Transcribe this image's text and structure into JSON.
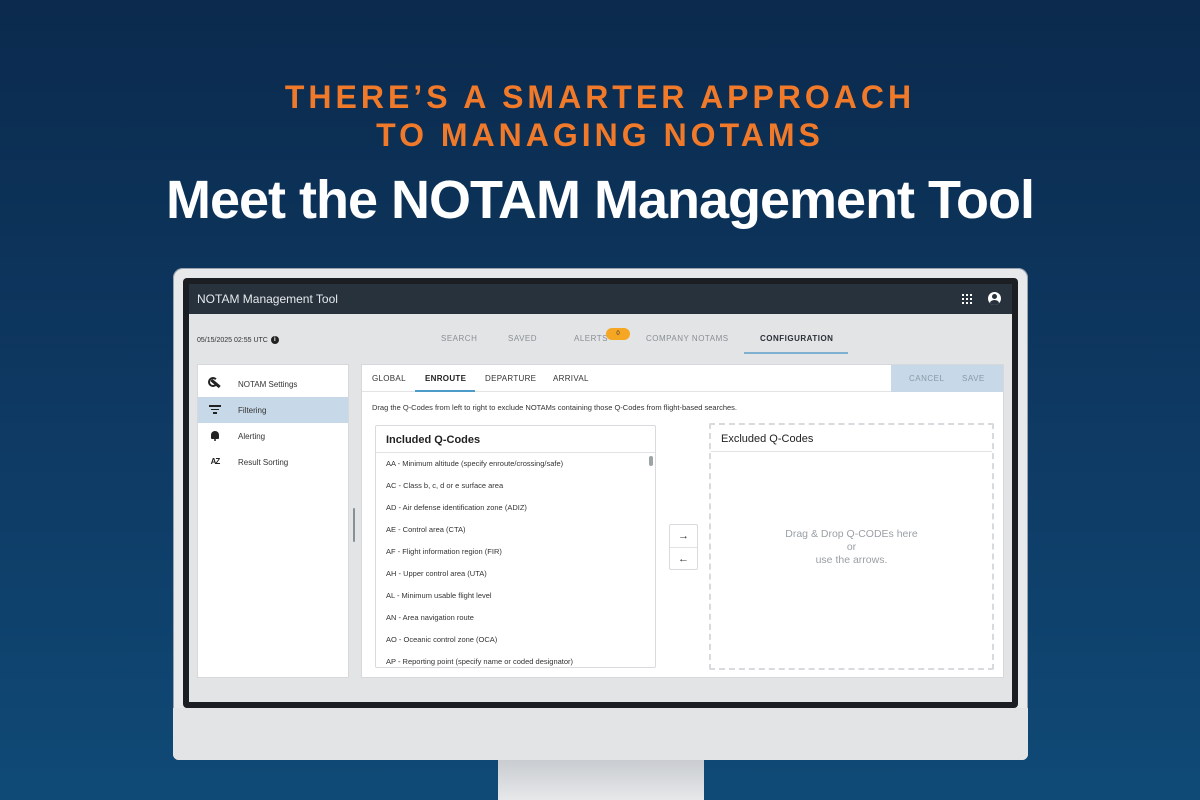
{
  "banner": {
    "kicker_line1": "THERE’S A SMARTER APPROACH",
    "kicker_line2": "TO MANAGING NOTAMS",
    "title": "Meet the NOTAM Management Tool"
  },
  "app": {
    "title": "NOTAM Management Tool",
    "date": "05/15/2025 02:55 UTC",
    "nav_tabs": [
      {
        "label": "SEARCH"
      },
      {
        "label": "SAVED"
      },
      {
        "label": "ALERTS",
        "badge": "0"
      },
      {
        "label": "COMPANY NOTAMs"
      },
      {
        "label": "CONFIGURATION",
        "active": true
      }
    ]
  },
  "sidebar": {
    "items": [
      {
        "label": "NOTAM Settings",
        "icon": "wrench-icon"
      },
      {
        "label": "Filtering",
        "icon": "filter-icon",
        "selected": true
      },
      {
        "label": "Alerting",
        "icon": "bell-icon"
      },
      {
        "label": "Result Sorting",
        "icon": "sort-az-icon",
        "icon_text": "AZ"
      }
    ]
  },
  "panel": {
    "subtabs": [
      {
        "label": "GLOBAL"
      },
      {
        "label": "ENROUTE",
        "active": true
      },
      {
        "label": "DEPARTURE"
      },
      {
        "label": "ARRIVAL"
      }
    ],
    "cancel_label": "CANCEL",
    "save_label": "SAVE",
    "instructions": "Drag the Q-Codes from left to right to exclude NOTAMs containing those Q-Codes from flight-based searches.",
    "included": {
      "title": "Included Q-Codes",
      "codes": [
        "AA - Minimum altitude (specify enroute/crossing/safe)",
        "AC - Class b, c, d or e surface area",
        "AD - Air defense identification zone (ADIZ)",
        "AE - Control area (CTA)",
        "AF - Flight information region (FIR)",
        "AH - Upper control area (UTA)",
        "AL - Minimum usable flight level",
        "AN - Area navigation route",
        "AO - Oceanic control zone (OCA)",
        "AP - Reporting point (specify name or coded designator)"
      ]
    },
    "arrows": {
      "right": "→",
      "left": "←"
    },
    "excluded": {
      "title": "Excluded Q-Codes",
      "hint_line1": "Drag & Drop Q-CODEs here",
      "hint_line2": "or",
      "hint_line3": "use the arrows."
    }
  }
}
